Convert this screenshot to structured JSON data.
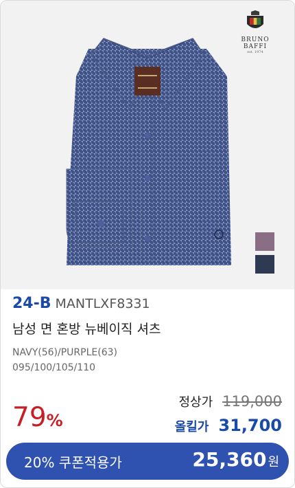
{
  "brand": {
    "name": "BRUNO BAFFI",
    "est": "est. 1974"
  },
  "product": {
    "code_prefix": "24-B",
    "code": "MANTLXF8331",
    "title": "남성 면 혼방 뉴베이직 셔츠",
    "colors": "NAVY(56)/PURPLE(63)",
    "sizes": "095/100/105/110",
    "swatches": [
      "#8a6e86",
      "#2e3a52"
    ]
  },
  "pricing": {
    "discount_num": "79",
    "discount_pct": "%",
    "regular_label": "정상가",
    "regular_price": "119,000",
    "sale_label": "올킬가",
    "sale_price": "31,700"
  },
  "coupon": {
    "label": "20% 쿠폰적용가",
    "price": "25,360",
    "unit": "원"
  },
  "colors": {
    "accent": "#1b4aa7",
    "discount": "#c71f26",
    "coupon_bg": "#2f52b1"
  }
}
